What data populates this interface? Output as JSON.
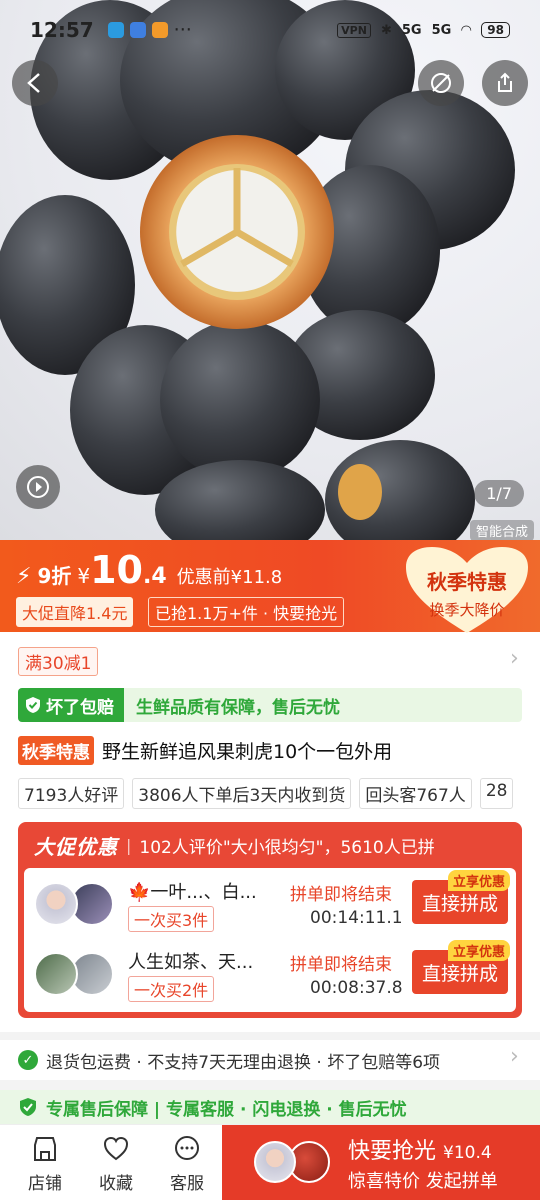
{
  "status_bar": {
    "time": "12:57",
    "signal": "5G",
    "battery": "98",
    "vpn": "VPN"
  },
  "hero": {
    "counter": "1/7",
    "ai_label": "智能合成"
  },
  "price": {
    "discount": "9折",
    "currency": "¥",
    "integer": "10",
    "decimal": ".4",
    "original": "优惠前¥11.8",
    "promo_tag": "大促直降1.4元",
    "sold_tag": "已抢1.1万+件 · 快要抢光",
    "badge_title": "秋季特惠",
    "badge_sub": "换季大降价"
  },
  "coupon": "满30减1",
  "guarantee": {
    "tag": "坏了包赔",
    "text": "生鲜品质有保障，售后无忧"
  },
  "product": {
    "tag": "秋季特惠",
    "title": "野生新鲜追风果刺虎10个一包外用"
  },
  "stats": [
    "7193人好评",
    "3806人下单后3天内收到货",
    "回头客767人",
    "28"
  ],
  "group": {
    "brand": "大促优惠",
    "info": "102人评价\"大小很均匀\"，5610人已拼",
    "rows": [
      {
        "name": "🍁一叶...、白...",
        "buy": "一次买3件",
        "status": "拼单即将结束",
        "timer": "00:14:11.1",
        "tag": "立享优惠",
        "button": "直接拼成"
      },
      {
        "name": "人生如茶、天...",
        "buy": "一次买2件",
        "status": "拼单即将结束",
        "timer": "00:08:37.8",
        "tag": "立享优惠",
        "button": "直接拼成"
      }
    ]
  },
  "services": {
    "row1": "退货包运费 · 不支持7天无理由退换 · 坏了包赔等6项",
    "row2": "专属售后保障 | 专属客服 · 闪电退换 · 售后无忧"
  },
  "bottom_bar": {
    "tabs": [
      {
        "label": "店铺",
        "icon": "store-icon"
      },
      {
        "label": "收藏",
        "icon": "heart-icon"
      },
      {
        "label": "客服",
        "icon": "chat-icon"
      }
    ],
    "buy_line1": "快要抢光",
    "buy_price": "¥10.4",
    "buy_line2": "惊喜特价 发起拼单"
  },
  "colors": {
    "accent": "#e8452a",
    "green": "#2fa83a",
    "orange": "#f25a1c"
  }
}
